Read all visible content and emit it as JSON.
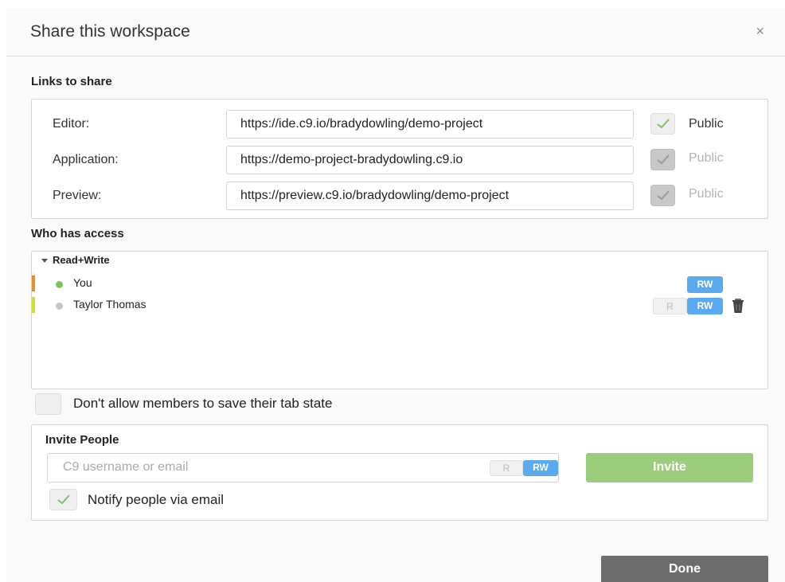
{
  "dialog": {
    "title": "Share this workspace",
    "close_symbol": "×"
  },
  "links": {
    "section_label": "Links to share",
    "rows": [
      {
        "label": "Editor:",
        "url": "https://ide.c9.io/bradydowling/demo-project",
        "public_label": "Public",
        "public_checked": true,
        "public_enabled": true
      },
      {
        "label": "Application:",
        "url": "https://demo-project-bradydowling.c9.io",
        "public_label": "Public",
        "public_checked": true,
        "public_enabled": false
      },
      {
        "label": "Preview:",
        "url": "https://preview.c9.io/bradydowling/demo-project",
        "public_label": "Public",
        "public_checked": true,
        "public_enabled": false
      }
    ]
  },
  "access": {
    "section_label": "Who has access",
    "group_label": "Read+Write",
    "members": [
      {
        "name": "You",
        "status_color": "#7dc35b",
        "bar_color": "#f08a24",
        "permission_label": "RW"
      },
      {
        "name": "Taylor Thomas",
        "status_color": "#c6c6c6",
        "bar_color": "#cfe22a",
        "read_label": "R",
        "permission_label": "RW",
        "icon": "trash-icon"
      }
    ]
  },
  "tab_state": {
    "label": "Don't allow members to save their tab state",
    "checked": false
  },
  "invite": {
    "section_label": "Invite People",
    "placeholder": "C9 username or email",
    "read_label": "R",
    "rw_label": "RW",
    "button_label": "Invite",
    "notify_label": "Notify people via email",
    "notify_checked": true
  },
  "footer": {
    "done_label": "Done"
  },
  "colors": {
    "accent_blue": "#5aaaf0",
    "check_green": "#7dc35b",
    "invite_green": "#9ccc7d",
    "done_gray": "#6d6d6d"
  }
}
